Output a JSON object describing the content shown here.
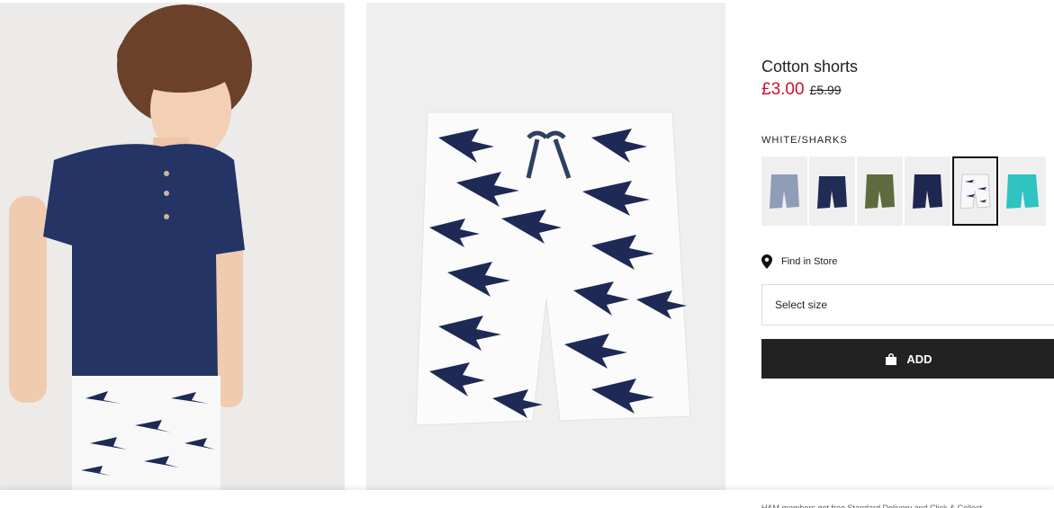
{
  "product": {
    "title": "Cotton shorts",
    "price_sale": "£3.00",
    "price_old": "£5.99",
    "color_label": "WHITE/SHARKS"
  },
  "swatches": [
    {
      "name": "blue-white-stripe",
      "color": "#8f9db8"
    },
    {
      "name": "dark-blue",
      "color": "#1f2d55"
    },
    {
      "name": "khaki-camo",
      "color": "#5f6a3f"
    },
    {
      "name": "navy",
      "color": "#1e2750"
    },
    {
      "name": "white-sharks",
      "color": "#f4f4f4",
      "selected": true
    },
    {
      "name": "turquoise",
      "color": "#2fc3c2"
    }
  ],
  "store": {
    "label": "Find in Store",
    "icon": "location-pin-icon"
  },
  "size": {
    "placeholder": "Select size"
  },
  "cart": {
    "label": "ADD",
    "icon": "shopping-bag-icon"
  },
  "colors": {
    "sale_red": "#c8102e",
    "button_bg": "#222222",
    "shark_navy": "#1e2a55"
  },
  "footer": {
    "text": "H&M members get free Standard Delivery and Click & Collect"
  }
}
